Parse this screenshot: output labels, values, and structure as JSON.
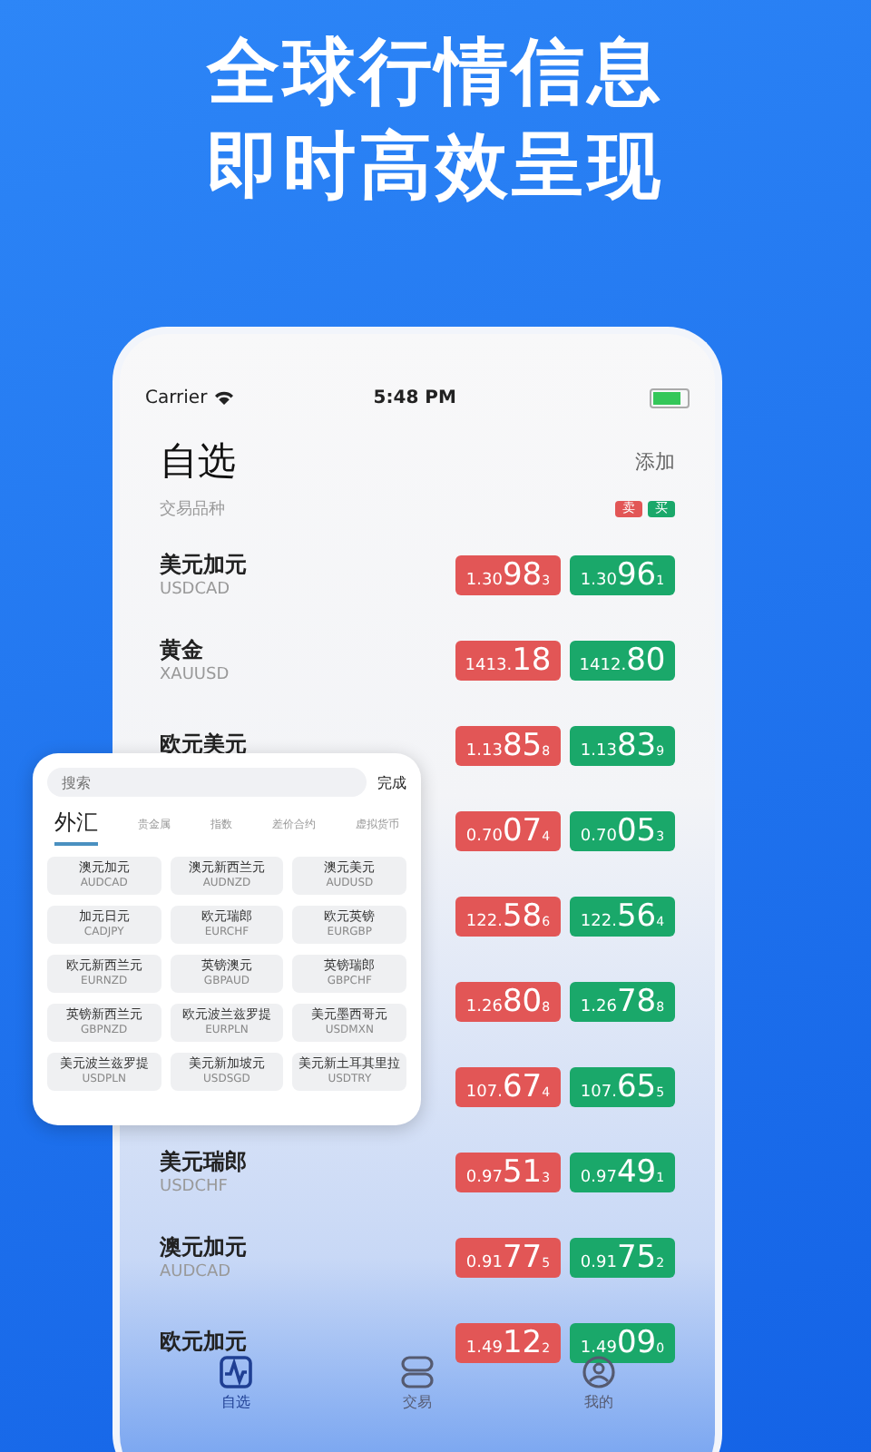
{
  "headline": [
    "全球行情信息",
    "即时高效呈现"
  ],
  "status_bar": {
    "carrier": "Carrier",
    "time": "5:48 PM"
  },
  "watchlist": {
    "title": "自选",
    "add": "添加",
    "subtitle": "交易品种",
    "legend": [
      {
        "label": "卖",
        "color": "#e25656"
      },
      {
        "label": "买",
        "color": "#1aa86a"
      }
    ],
    "rows": [
      {
        "name": "美元加元",
        "code": "USDCAD",
        "sell": {
          "pre": "1.30",
          "big": "98",
          "sup": "3"
        },
        "buy": {
          "pre": "1.30",
          "big": "96",
          "sup": "1"
        }
      },
      {
        "name": "黄金",
        "code": "XAUUSD",
        "sell": {
          "pre": "1413.",
          "big": "18"
        },
        "buy": {
          "pre": "1412.",
          "big": "80"
        }
      },
      {
        "name": "欧元美元",
        "sell": {
          "pre": "1.13",
          "big": "85",
          "sup": "8"
        },
        "buy": {
          "pre": "1.13",
          "big": "83",
          "sup": "9"
        }
      },
      {
        "sell": {
          "pre": "0.70",
          "big": "07",
          "sup": "4"
        },
        "buy": {
          "pre": "0.70",
          "big": "05",
          "sup": "3"
        }
      },
      {
        "sell": {
          "pre": "122.",
          "big": "58",
          "sup": "6"
        },
        "buy": {
          "pre": "122.",
          "big": "56",
          "sup": "4"
        }
      },
      {
        "sell": {
          "pre": "1.26",
          "big": "80",
          "sup": "8"
        },
        "buy": {
          "pre": "1.26",
          "big": "78",
          "sup": "8"
        }
      },
      {
        "sell": {
          "pre": "107.",
          "big": "67",
          "sup": "4"
        },
        "buy": {
          "pre": "107.",
          "big": "65",
          "sup": "5"
        }
      },
      {
        "name": "美元瑞郎",
        "code": "USDCHF",
        "sell": {
          "pre": "0.97",
          "big": "51",
          "sup": "3"
        },
        "buy": {
          "pre": "0.97",
          "big": "49",
          "sup": "1"
        }
      },
      {
        "name": "澳元加元",
        "code": "AUDCAD",
        "sell": {
          "pre": "0.91",
          "big": "77",
          "sup": "5"
        },
        "buy": {
          "pre": "0.91",
          "big": "75",
          "sup": "2"
        }
      },
      {
        "name": "欧元加元",
        "sell": {
          "pre": "1.49",
          "big": "12",
          "sup": "2"
        },
        "buy": {
          "pre": "1.49",
          "big": "09",
          "sup": "0"
        }
      }
    ]
  },
  "tab_bar": [
    {
      "label": "自选",
      "kind": "chart",
      "selected": true
    },
    {
      "label": "交易",
      "kind": "stack",
      "selected": false
    },
    {
      "label": "我的",
      "kind": "user",
      "selected": false
    }
  ],
  "picker": {
    "search_placeholder": "搜索",
    "done": "完成",
    "tabs": [
      {
        "label": "外汇",
        "selected": true
      },
      {
        "label": "贵金属",
        "selected": false
      },
      {
        "label": "指数",
        "selected": false
      },
      {
        "label": "差价合约",
        "selected": false
      },
      {
        "label": "虚拟货币",
        "selected": false
      }
    ],
    "items": [
      {
        "name": "澳元加元",
        "code": "AUDCAD"
      },
      {
        "name": "澳元新西兰元",
        "code": "AUDNZD"
      },
      {
        "name": "澳元美元",
        "code": "AUDUSD"
      },
      {
        "name": "加元日元",
        "code": "CADJPY"
      },
      {
        "name": "欧元瑞郎",
        "code": "EURCHF"
      },
      {
        "name": "欧元英镑",
        "code": "EURGBP"
      },
      {
        "name": "欧元新西兰元",
        "code": "EURNZD"
      },
      {
        "name": "英镑澳元",
        "code": "GBPAUD"
      },
      {
        "name": "英镑瑞郎",
        "code": "GBPCHF"
      },
      {
        "name": "英镑新西兰元",
        "code": "GBPNZD"
      },
      {
        "name": "欧元波兰兹罗提",
        "code": "EURPLN"
      },
      {
        "name": "美元墨西哥元",
        "code": "USDMXN"
      },
      {
        "name": "美元波兰兹罗提",
        "code": "USDPLN"
      },
      {
        "name": "美元新加坡元",
        "code": "USDSGD"
      },
      {
        "name": "美元新土耳其里拉",
        "code": "USDTRY"
      }
    ]
  }
}
